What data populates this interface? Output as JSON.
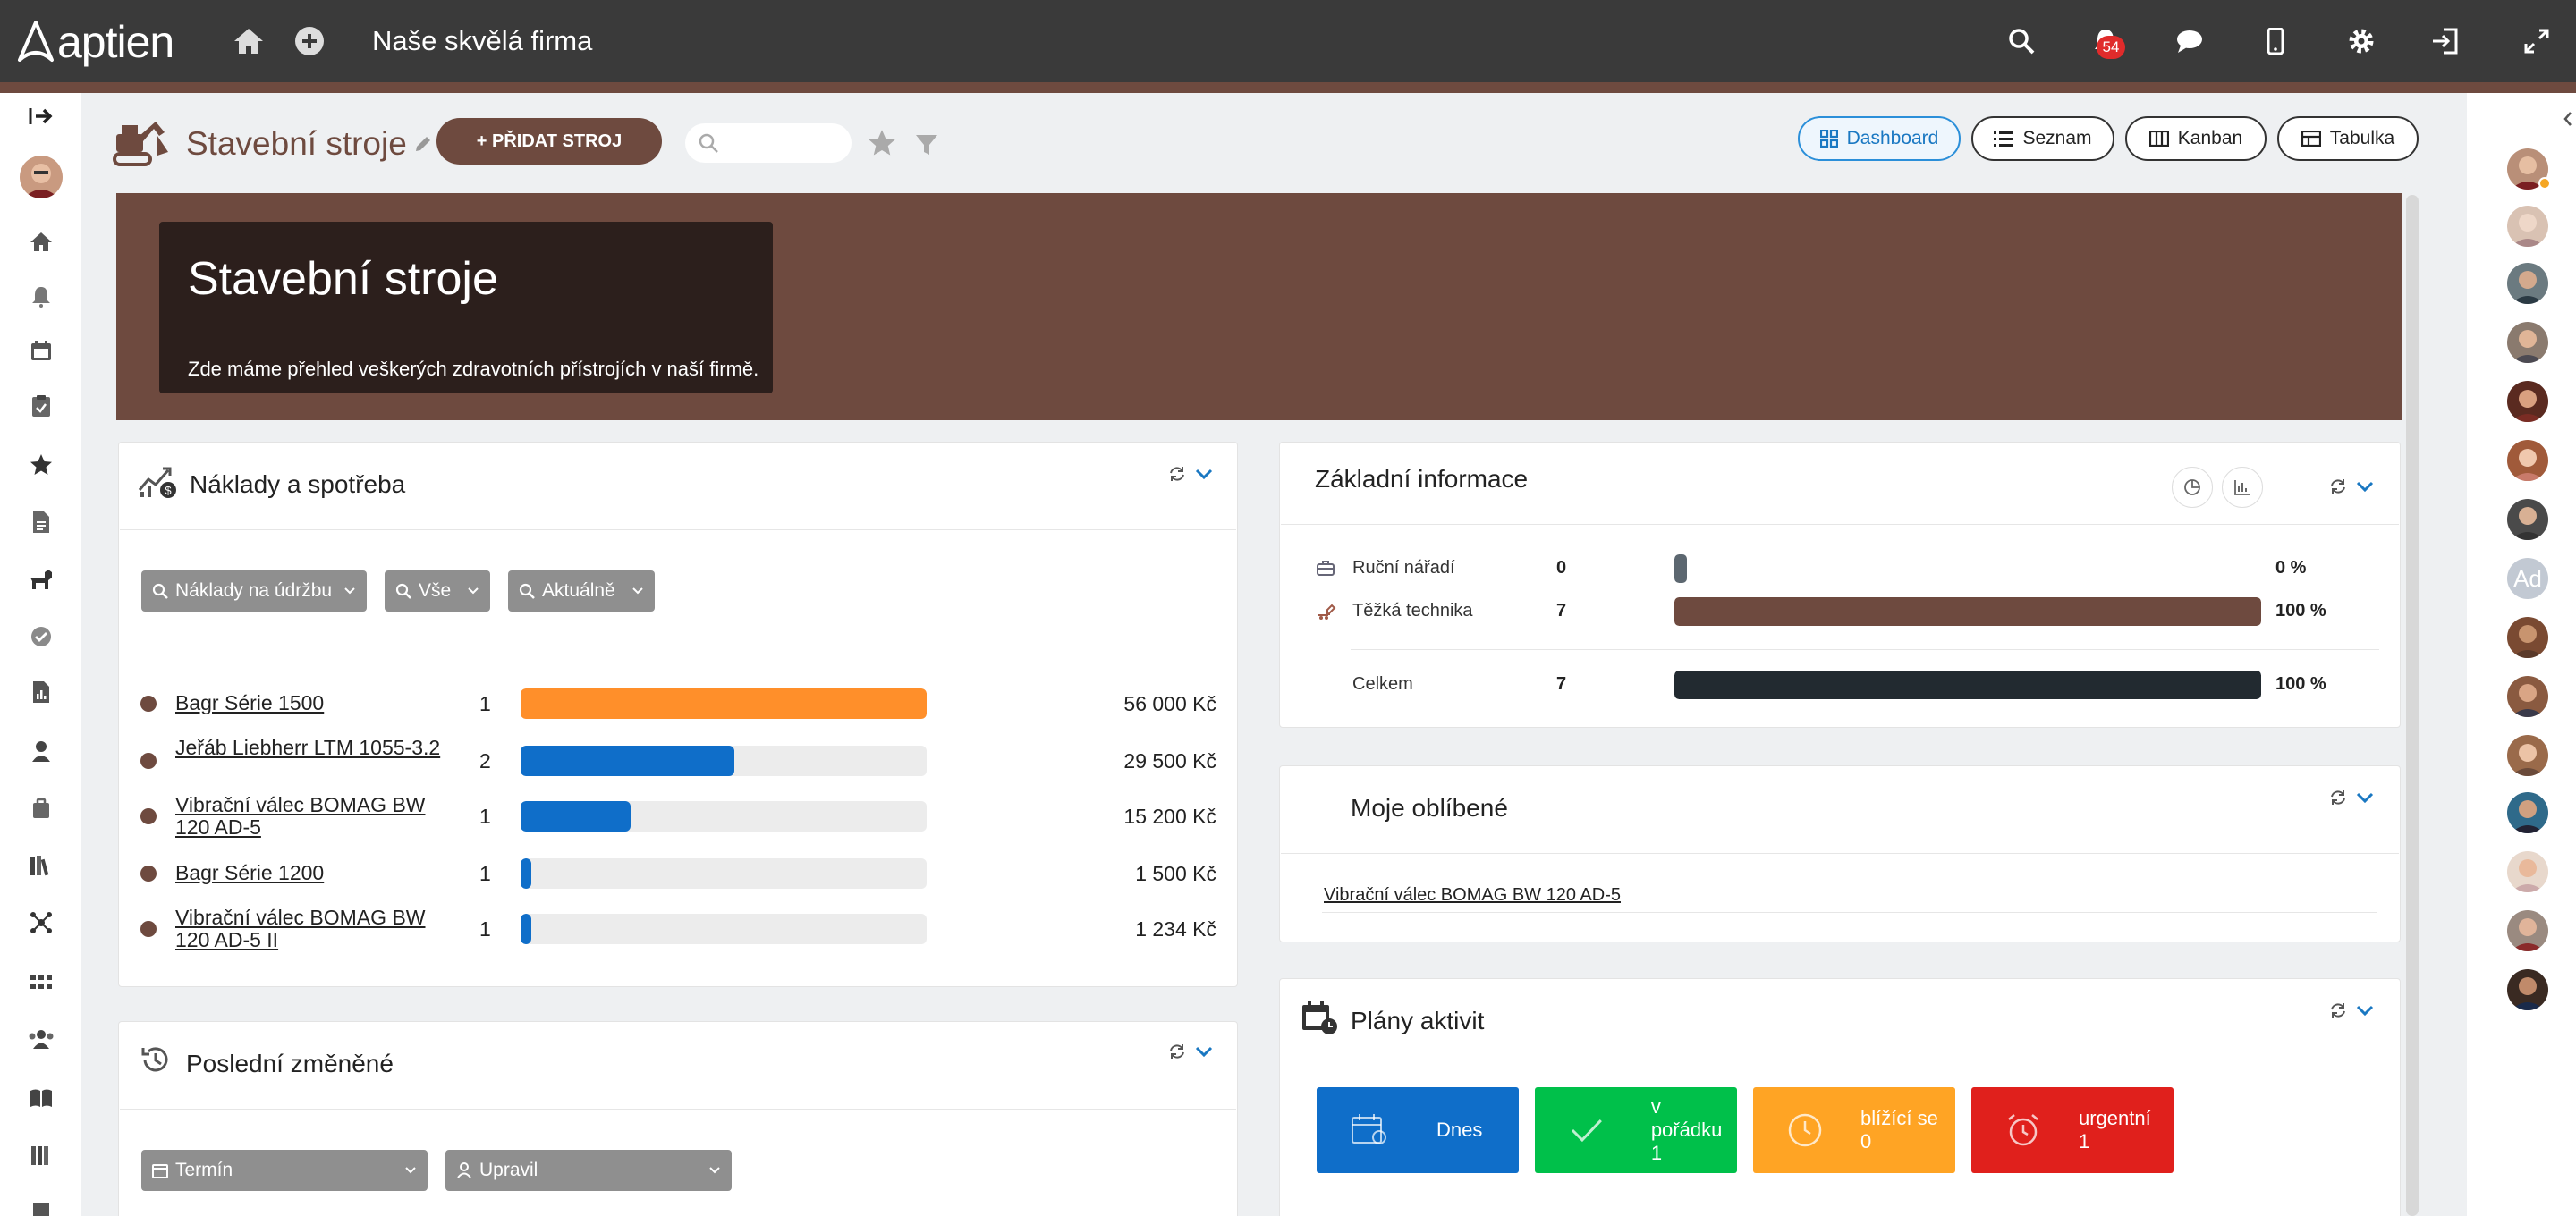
{
  "app": {
    "logo_text": "aptien",
    "company": "Naše skvělá firma",
    "notification_count": "54"
  },
  "colors": {
    "brand": "#6e4a3f",
    "orange": "#ff8f2a",
    "blue": "#0f6ec9",
    "green": "#00c04a",
    "amber": "#ffa424",
    "red": "#e0201c"
  },
  "page": {
    "title": "Stavební stroje",
    "add_label": "+ PŘIDAT STROJ",
    "search_placeholder": "",
    "views": [
      "Dashboard",
      "Seznam",
      "Kanban",
      "Tabulka"
    ]
  },
  "banner": {
    "title": "Stavební stroje",
    "description": "Zde máme přehled veškerých zdravotních přístrojích v naší firmě."
  },
  "costs": {
    "title": "Náklady a spotřeba",
    "filters": [
      "Náklady na údržbu",
      "Vše",
      "Aktuálně"
    ],
    "items": [
      {
        "name": "Bagr Série 1500",
        "count": "1",
        "value": "56 000 Kč",
        "fraction": 1.0
      },
      {
        "name": "Jeřáb Liebherr LTM 1055-3.2",
        "count": "2",
        "value": "29 500 Kč",
        "fraction": 0.527
      },
      {
        "name": "Vibrační válec BOMAG BW 120 AD-5",
        "count": "1",
        "value": "15 200 Kč",
        "fraction": 0.271
      },
      {
        "name": "Bagr Série 1200",
        "count": "1",
        "value": "1 500 Kč",
        "fraction": 0.027
      },
      {
        "name": "Vibrační válec BOMAG BW 120 AD-5 II",
        "count": "1",
        "value": "1 234 Kč",
        "fraction": 0.022
      }
    ]
  },
  "basic_info": {
    "title": "Základní informace",
    "rows": [
      {
        "label": "Ruční nářadí",
        "count": "0",
        "percent": "0 %",
        "fraction": 0
      },
      {
        "label": "Těžká technika",
        "count": "7",
        "percent": "100 %",
        "fraction": 1
      },
      {
        "label": "Celkem",
        "count": "7",
        "percent": "100 %",
        "fraction": 1
      }
    ]
  },
  "favorites": {
    "title": "Moje oblíbené",
    "items": [
      "Vibrační válec BOMAG BW 120 AD-5"
    ]
  },
  "recent": {
    "title": "Poslední změněné",
    "filters": [
      "Termín",
      "Upravil"
    ]
  },
  "activities": {
    "title": "Plány aktivit",
    "tiles": [
      {
        "label": "Dnes",
        "count": ""
      },
      {
        "label": "v pořádku",
        "count": "1"
      },
      {
        "label": "blížící se",
        "count": "0"
      },
      {
        "label": "urgentní",
        "count": "1"
      }
    ]
  },
  "sidebar_icons": [
    "collapse-icon",
    "home-icon",
    "bell-icon",
    "calendar-icon",
    "clipboard-icon",
    "star-icon",
    "document-icon",
    "dog-icon",
    "check-circle-icon",
    "report-icon",
    "person-icon",
    "briefcase-icon",
    "library-icon",
    "network-icon",
    "apps-icon",
    "team-icon",
    "book-icon",
    "books-icon"
  ]
}
